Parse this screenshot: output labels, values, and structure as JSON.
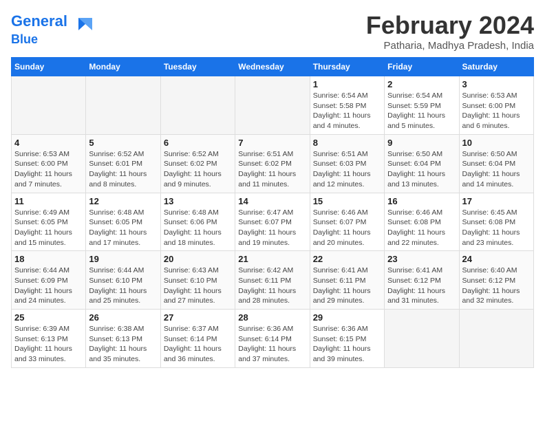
{
  "header": {
    "logo_line1": "General",
    "logo_line2": "Blue",
    "month_year": "February 2024",
    "location": "Patharia, Madhya Pradesh, India"
  },
  "weekdays": [
    "Sunday",
    "Monday",
    "Tuesday",
    "Wednesday",
    "Thursday",
    "Friday",
    "Saturday"
  ],
  "weeks": [
    [
      {
        "num": "",
        "sunrise": "",
        "sunset": "",
        "daylight": ""
      },
      {
        "num": "",
        "sunrise": "",
        "sunset": "",
        "daylight": ""
      },
      {
        "num": "",
        "sunrise": "",
        "sunset": "",
        "daylight": ""
      },
      {
        "num": "",
        "sunrise": "",
        "sunset": "",
        "daylight": ""
      },
      {
        "num": "1",
        "sunrise": "Sunrise: 6:54 AM",
        "sunset": "Sunset: 5:58 PM",
        "daylight": "Daylight: 11 hours and 4 minutes."
      },
      {
        "num": "2",
        "sunrise": "Sunrise: 6:54 AM",
        "sunset": "Sunset: 5:59 PM",
        "daylight": "Daylight: 11 hours and 5 minutes."
      },
      {
        "num": "3",
        "sunrise": "Sunrise: 6:53 AM",
        "sunset": "Sunset: 6:00 PM",
        "daylight": "Daylight: 11 hours and 6 minutes."
      }
    ],
    [
      {
        "num": "4",
        "sunrise": "Sunrise: 6:53 AM",
        "sunset": "Sunset: 6:00 PM",
        "daylight": "Daylight: 11 hours and 7 minutes."
      },
      {
        "num": "5",
        "sunrise": "Sunrise: 6:52 AM",
        "sunset": "Sunset: 6:01 PM",
        "daylight": "Daylight: 11 hours and 8 minutes."
      },
      {
        "num": "6",
        "sunrise": "Sunrise: 6:52 AM",
        "sunset": "Sunset: 6:02 PM",
        "daylight": "Daylight: 11 hours and 9 minutes."
      },
      {
        "num": "7",
        "sunrise": "Sunrise: 6:51 AM",
        "sunset": "Sunset: 6:02 PM",
        "daylight": "Daylight: 11 hours and 11 minutes."
      },
      {
        "num": "8",
        "sunrise": "Sunrise: 6:51 AM",
        "sunset": "Sunset: 6:03 PM",
        "daylight": "Daylight: 11 hours and 12 minutes."
      },
      {
        "num": "9",
        "sunrise": "Sunrise: 6:50 AM",
        "sunset": "Sunset: 6:04 PM",
        "daylight": "Daylight: 11 hours and 13 minutes."
      },
      {
        "num": "10",
        "sunrise": "Sunrise: 6:50 AM",
        "sunset": "Sunset: 6:04 PM",
        "daylight": "Daylight: 11 hours and 14 minutes."
      }
    ],
    [
      {
        "num": "11",
        "sunrise": "Sunrise: 6:49 AM",
        "sunset": "Sunset: 6:05 PM",
        "daylight": "Daylight: 11 hours and 15 minutes."
      },
      {
        "num": "12",
        "sunrise": "Sunrise: 6:48 AM",
        "sunset": "Sunset: 6:05 PM",
        "daylight": "Daylight: 11 hours and 17 minutes."
      },
      {
        "num": "13",
        "sunrise": "Sunrise: 6:48 AM",
        "sunset": "Sunset: 6:06 PM",
        "daylight": "Daylight: 11 hours and 18 minutes."
      },
      {
        "num": "14",
        "sunrise": "Sunrise: 6:47 AM",
        "sunset": "Sunset: 6:07 PM",
        "daylight": "Daylight: 11 hours and 19 minutes."
      },
      {
        "num": "15",
        "sunrise": "Sunrise: 6:46 AM",
        "sunset": "Sunset: 6:07 PM",
        "daylight": "Daylight: 11 hours and 20 minutes."
      },
      {
        "num": "16",
        "sunrise": "Sunrise: 6:46 AM",
        "sunset": "Sunset: 6:08 PM",
        "daylight": "Daylight: 11 hours and 22 minutes."
      },
      {
        "num": "17",
        "sunrise": "Sunrise: 6:45 AM",
        "sunset": "Sunset: 6:08 PM",
        "daylight": "Daylight: 11 hours and 23 minutes."
      }
    ],
    [
      {
        "num": "18",
        "sunrise": "Sunrise: 6:44 AM",
        "sunset": "Sunset: 6:09 PM",
        "daylight": "Daylight: 11 hours and 24 minutes."
      },
      {
        "num": "19",
        "sunrise": "Sunrise: 6:44 AM",
        "sunset": "Sunset: 6:10 PM",
        "daylight": "Daylight: 11 hours and 25 minutes."
      },
      {
        "num": "20",
        "sunrise": "Sunrise: 6:43 AM",
        "sunset": "Sunset: 6:10 PM",
        "daylight": "Daylight: 11 hours and 27 minutes."
      },
      {
        "num": "21",
        "sunrise": "Sunrise: 6:42 AM",
        "sunset": "Sunset: 6:11 PM",
        "daylight": "Daylight: 11 hours and 28 minutes."
      },
      {
        "num": "22",
        "sunrise": "Sunrise: 6:41 AM",
        "sunset": "Sunset: 6:11 PM",
        "daylight": "Daylight: 11 hours and 29 minutes."
      },
      {
        "num": "23",
        "sunrise": "Sunrise: 6:41 AM",
        "sunset": "Sunset: 6:12 PM",
        "daylight": "Daylight: 11 hours and 31 minutes."
      },
      {
        "num": "24",
        "sunrise": "Sunrise: 6:40 AM",
        "sunset": "Sunset: 6:12 PM",
        "daylight": "Daylight: 11 hours and 32 minutes."
      }
    ],
    [
      {
        "num": "25",
        "sunrise": "Sunrise: 6:39 AM",
        "sunset": "Sunset: 6:13 PM",
        "daylight": "Daylight: 11 hours and 33 minutes."
      },
      {
        "num": "26",
        "sunrise": "Sunrise: 6:38 AM",
        "sunset": "Sunset: 6:13 PM",
        "daylight": "Daylight: 11 hours and 35 minutes."
      },
      {
        "num": "27",
        "sunrise": "Sunrise: 6:37 AM",
        "sunset": "Sunset: 6:14 PM",
        "daylight": "Daylight: 11 hours and 36 minutes."
      },
      {
        "num": "28",
        "sunrise": "Sunrise: 6:36 AM",
        "sunset": "Sunset: 6:14 PM",
        "daylight": "Daylight: 11 hours and 37 minutes."
      },
      {
        "num": "29",
        "sunrise": "Sunrise: 6:36 AM",
        "sunset": "Sunset: 6:15 PM",
        "daylight": "Daylight: 11 hours and 39 minutes."
      },
      {
        "num": "",
        "sunrise": "",
        "sunset": "",
        "daylight": ""
      },
      {
        "num": "",
        "sunrise": "",
        "sunset": "",
        "daylight": ""
      }
    ]
  ]
}
